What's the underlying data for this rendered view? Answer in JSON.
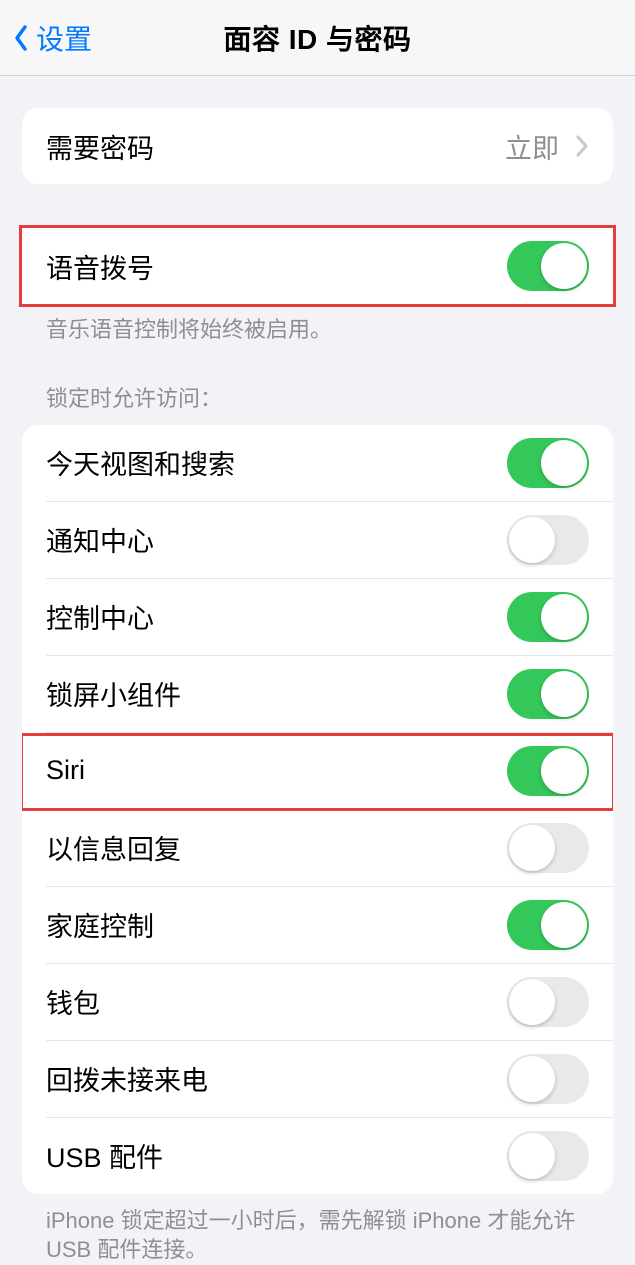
{
  "header": {
    "back_label": "设置",
    "title": "面容 ID 与密码"
  },
  "require_passcode": {
    "label": "需要密码",
    "value": "立即"
  },
  "voice_dial": {
    "label": "语音拨号",
    "on": true,
    "footnote": "音乐语音控制将始终被启用。"
  },
  "locked_section_header": "锁定时允许访问：",
  "locked_items": [
    {
      "label": "今天视图和搜索",
      "on": true
    },
    {
      "label": "通知中心",
      "on": false
    },
    {
      "label": "控制中心",
      "on": true
    },
    {
      "label": "锁屏小组件",
      "on": true
    },
    {
      "label": "Siri",
      "on": true,
      "highlighted": true
    },
    {
      "label": "以信息回复",
      "on": false
    },
    {
      "label": "家庭控制",
      "on": true
    },
    {
      "label": "钱包",
      "on": false
    },
    {
      "label": "回拨未接来电",
      "on": false
    },
    {
      "label": "USB 配件",
      "on": false
    }
  ],
  "usb_footnote": "iPhone 锁定超过一小时后，需先解锁 iPhone 才能允许 USB 配件连接。"
}
